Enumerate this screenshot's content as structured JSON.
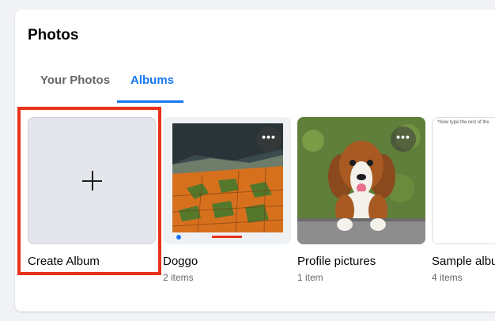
{
  "header": {
    "title": "Photos"
  },
  "tabs": [
    {
      "label": "Your Photos",
      "active": false
    },
    {
      "label": "Albums",
      "active": true
    }
  ],
  "albums": [
    {
      "title": "Create Album",
      "count": ""
    },
    {
      "title": "Doggo",
      "count": "2 items"
    },
    {
      "title": "Profile pictures",
      "count": "1 item"
    },
    {
      "title": "Sample albu",
      "count": "4 items",
      "preview_text": "*Now type the rest of the"
    }
  ],
  "more_label": "•••",
  "colors": {
    "accent": "#1877f2",
    "highlight": "#e8321a",
    "background": "#f0f2f5"
  },
  "icons": {
    "create": "plus-icon",
    "more": "more-horizontal-icon"
  }
}
